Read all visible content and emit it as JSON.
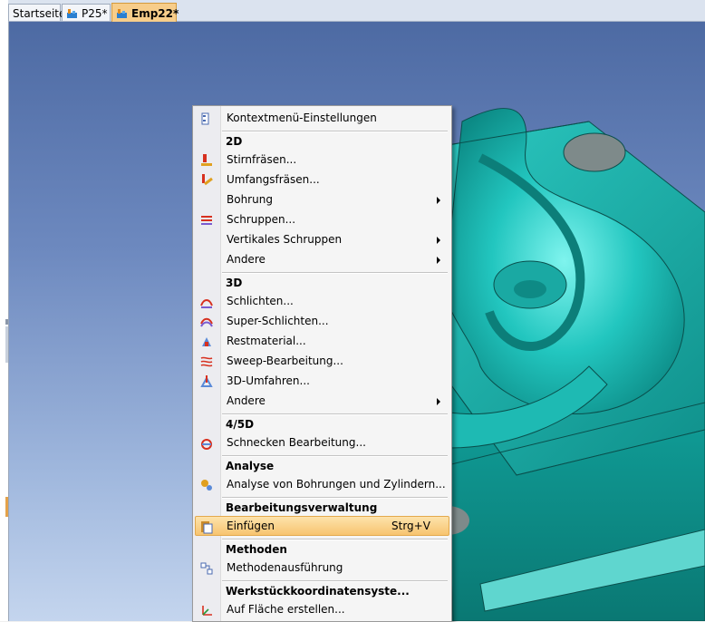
{
  "tabs": [
    {
      "label": "Startseite",
      "icon": "none",
      "active": false
    },
    {
      "label": "P25*",
      "icon": "part-icon",
      "active": false
    },
    {
      "label": "Emp22*",
      "icon": "part-icon",
      "active": true
    }
  ],
  "menu": {
    "settings_label": "Kontextmenü-Einstellungen",
    "section_2d": "2D",
    "stirnfraesen": "Stirnfräsen...",
    "umfangsfraesen": "Umfangsfräsen...",
    "bohrung": "Bohrung",
    "schruppen": "Schruppen...",
    "vertikales_schruppen": "Vertikales Schruppen",
    "andere_2d": "Andere",
    "section_3d": "3D",
    "schlichten": "Schlichten...",
    "super_schlichten": "Super-Schlichten...",
    "restmaterial": "Restmaterial...",
    "sweep": "Sweep-Bearbeitung...",
    "umfahren_3d": "3D-Umfahren...",
    "andere_3d": "Andere",
    "section_45d": "4/5D",
    "schnecken": "Schnecken Bearbeitung...",
    "section_analyse": "Analyse",
    "analyse_bohrungen": "Analyse von Bohrungen und Zylindern...",
    "section_verwaltung": "Bearbeitungsverwaltung",
    "einfuegen": "Einfügen",
    "einfuegen_shortcut": "Strg+V",
    "section_methoden": "Methoden",
    "methodenausfuehrung": "Methodenausführung",
    "section_wks": "Werkstückkoordinatensyste...",
    "auf_flaeche": "Auf Fläche erstellen..."
  },
  "colors": {
    "highlight": "#f7c46f",
    "model": "#1fb3ad",
    "background_top": "#4d6aa3",
    "background_bottom": "#c4d5ee"
  }
}
